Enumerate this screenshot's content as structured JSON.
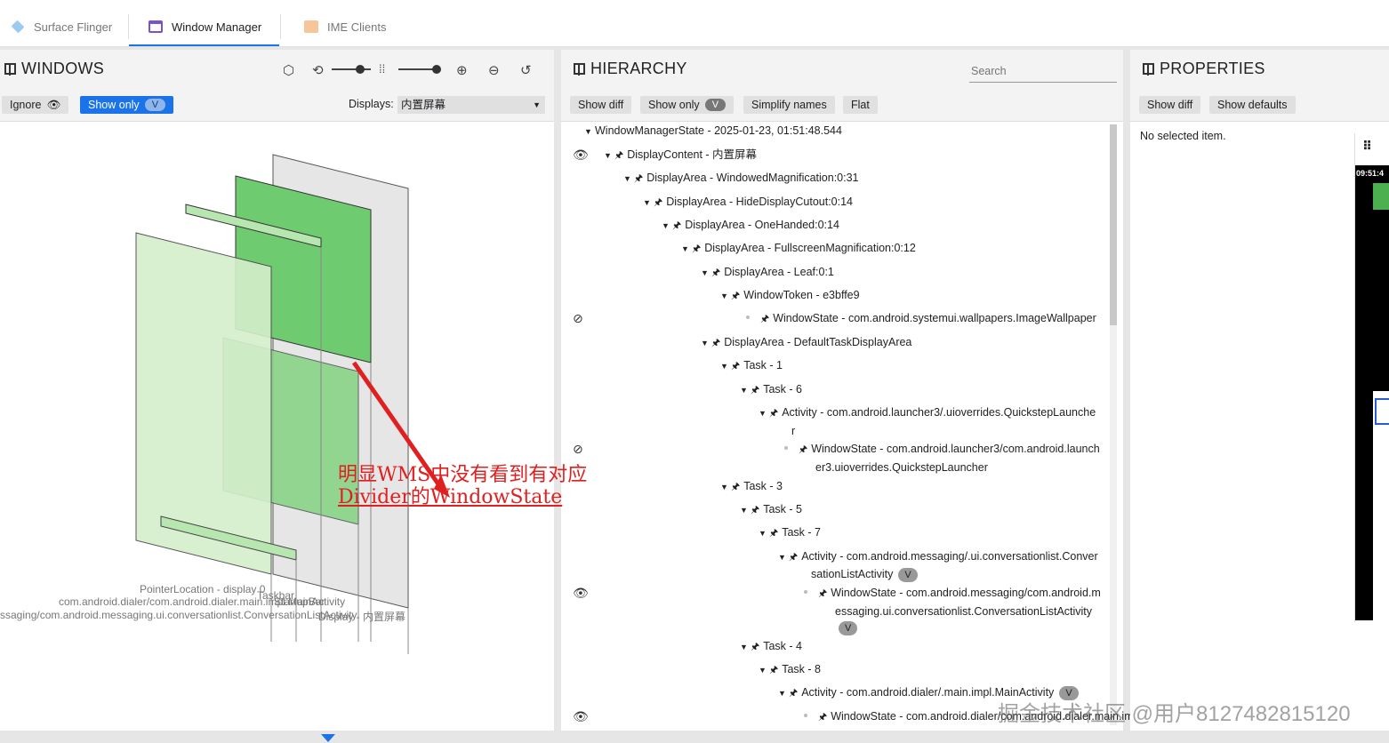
{
  "tabs": [
    {
      "label": "Surface Flinger",
      "color": "#6ab0e8"
    },
    {
      "label": "Window Manager",
      "color": "#7b52c9"
    },
    {
      "label": "IME Clients",
      "color": "#f0a060"
    }
  ],
  "windows": {
    "title": "WINDOWS",
    "ignore_label": "Ignore",
    "show_only_label": "Show only",
    "v_badge": "V",
    "displays_label": "Displays:",
    "displays_value": "内置屏幕",
    "tools": [
      "cube-icon",
      "rotate-icon",
      "spacing-icon",
      "zoom-in-icon",
      "zoom-out-icon",
      "reset-icon"
    ],
    "layer_labels": {
      "pointer": "PointerLocation - display 0",
      "taskbar": "Taskbar",
      "dialer": "com.android.dialer/com.android.dialer.main.impl.MainActivity",
      "startup": "StartupBar",
      "messaging": "ssaging/com.android.messaging.ui.conversationlist.ConversationListActivity",
      "display": "Display - 内置屏幕"
    }
  },
  "hierarchy": {
    "title": "HIERARCHY",
    "search_placeholder": "Search",
    "buttons": {
      "show_diff": "Show diff",
      "show_only": "Show only",
      "v_badge": "V",
      "simplify": "Simplify names",
      "flat": "Flat"
    },
    "rows": [
      {
        "text": "WindowManagerState - 2025-01-23, 01:51:48.544"
      },
      {
        "text": "DisplayContent - 内置屏幕"
      },
      {
        "text": "DisplayArea - WindowedMagnification:0:31"
      },
      {
        "text": "DisplayArea - HideDisplayCutout:0:14"
      },
      {
        "text": "DisplayArea - OneHanded:0:14"
      },
      {
        "text": "DisplayArea - FullscreenMagnification:0:12"
      },
      {
        "text": "DisplayArea - Leaf:0:1"
      },
      {
        "text": "WindowToken - e3bffe9"
      },
      {
        "text": "WindowState - com.android.systemui.wallpapers.ImageWallpaper"
      },
      {
        "text": "DisplayArea - DefaultTaskDisplayArea"
      },
      {
        "text": "Task - 1"
      },
      {
        "text": "Task - 6"
      },
      {
        "text": "Activity - com.android.launcher3/.uioverrides.QuickstepLaunche",
        "cont": "r"
      },
      {
        "text": "WindowState - com.android.launcher3/com.android.launch",
        "cont": "er3.uioverrides.QuickstepLauncher"
      },
      {
        "text": "Task - 3"
      },
      {
        "text": "Task - 5"
      },
      {
        "text": "Task - 7"
      },
      {
        "text": "Activity - com.android.messaging/.ui.conversationlist.Conver",
        "cont": "sationListActivity",
        "badge": "V"
      },
      {
        "text": "WindowState - com.android.messaging/com.android.m",
        "cont": "essaging.ui.conversationlist.ConversationListActivity",
        "badge": "V"
      },
      {
        "text": "Task - 4"
      },
      {
        "text": "Task - 8"
      },
      {
        "text": "Activity - com.android.dialer/.main.impl.MainActivity",
        "badge": "V"
      },
      {
        "text": "WindowState - com.android.dialer/com.android.dialer.main.impl.MainActivity"
      }
    ]
  },
  "properties": {
    "title": "PROPERTIES",
    "show_diff": "Show diff",
    "show_defaults": "Show defaults",
    "empty": "No selected item.",
    "preview_time": "09:51:4"
  },
  "annotation": {
    "line1": "明显WMS中没有看到有对应",
    "line2": "Divider的WindowState",
    "color": "#e02020"
  },
  "watermark": "掘金技术社区 @用户8127482815120"
}
